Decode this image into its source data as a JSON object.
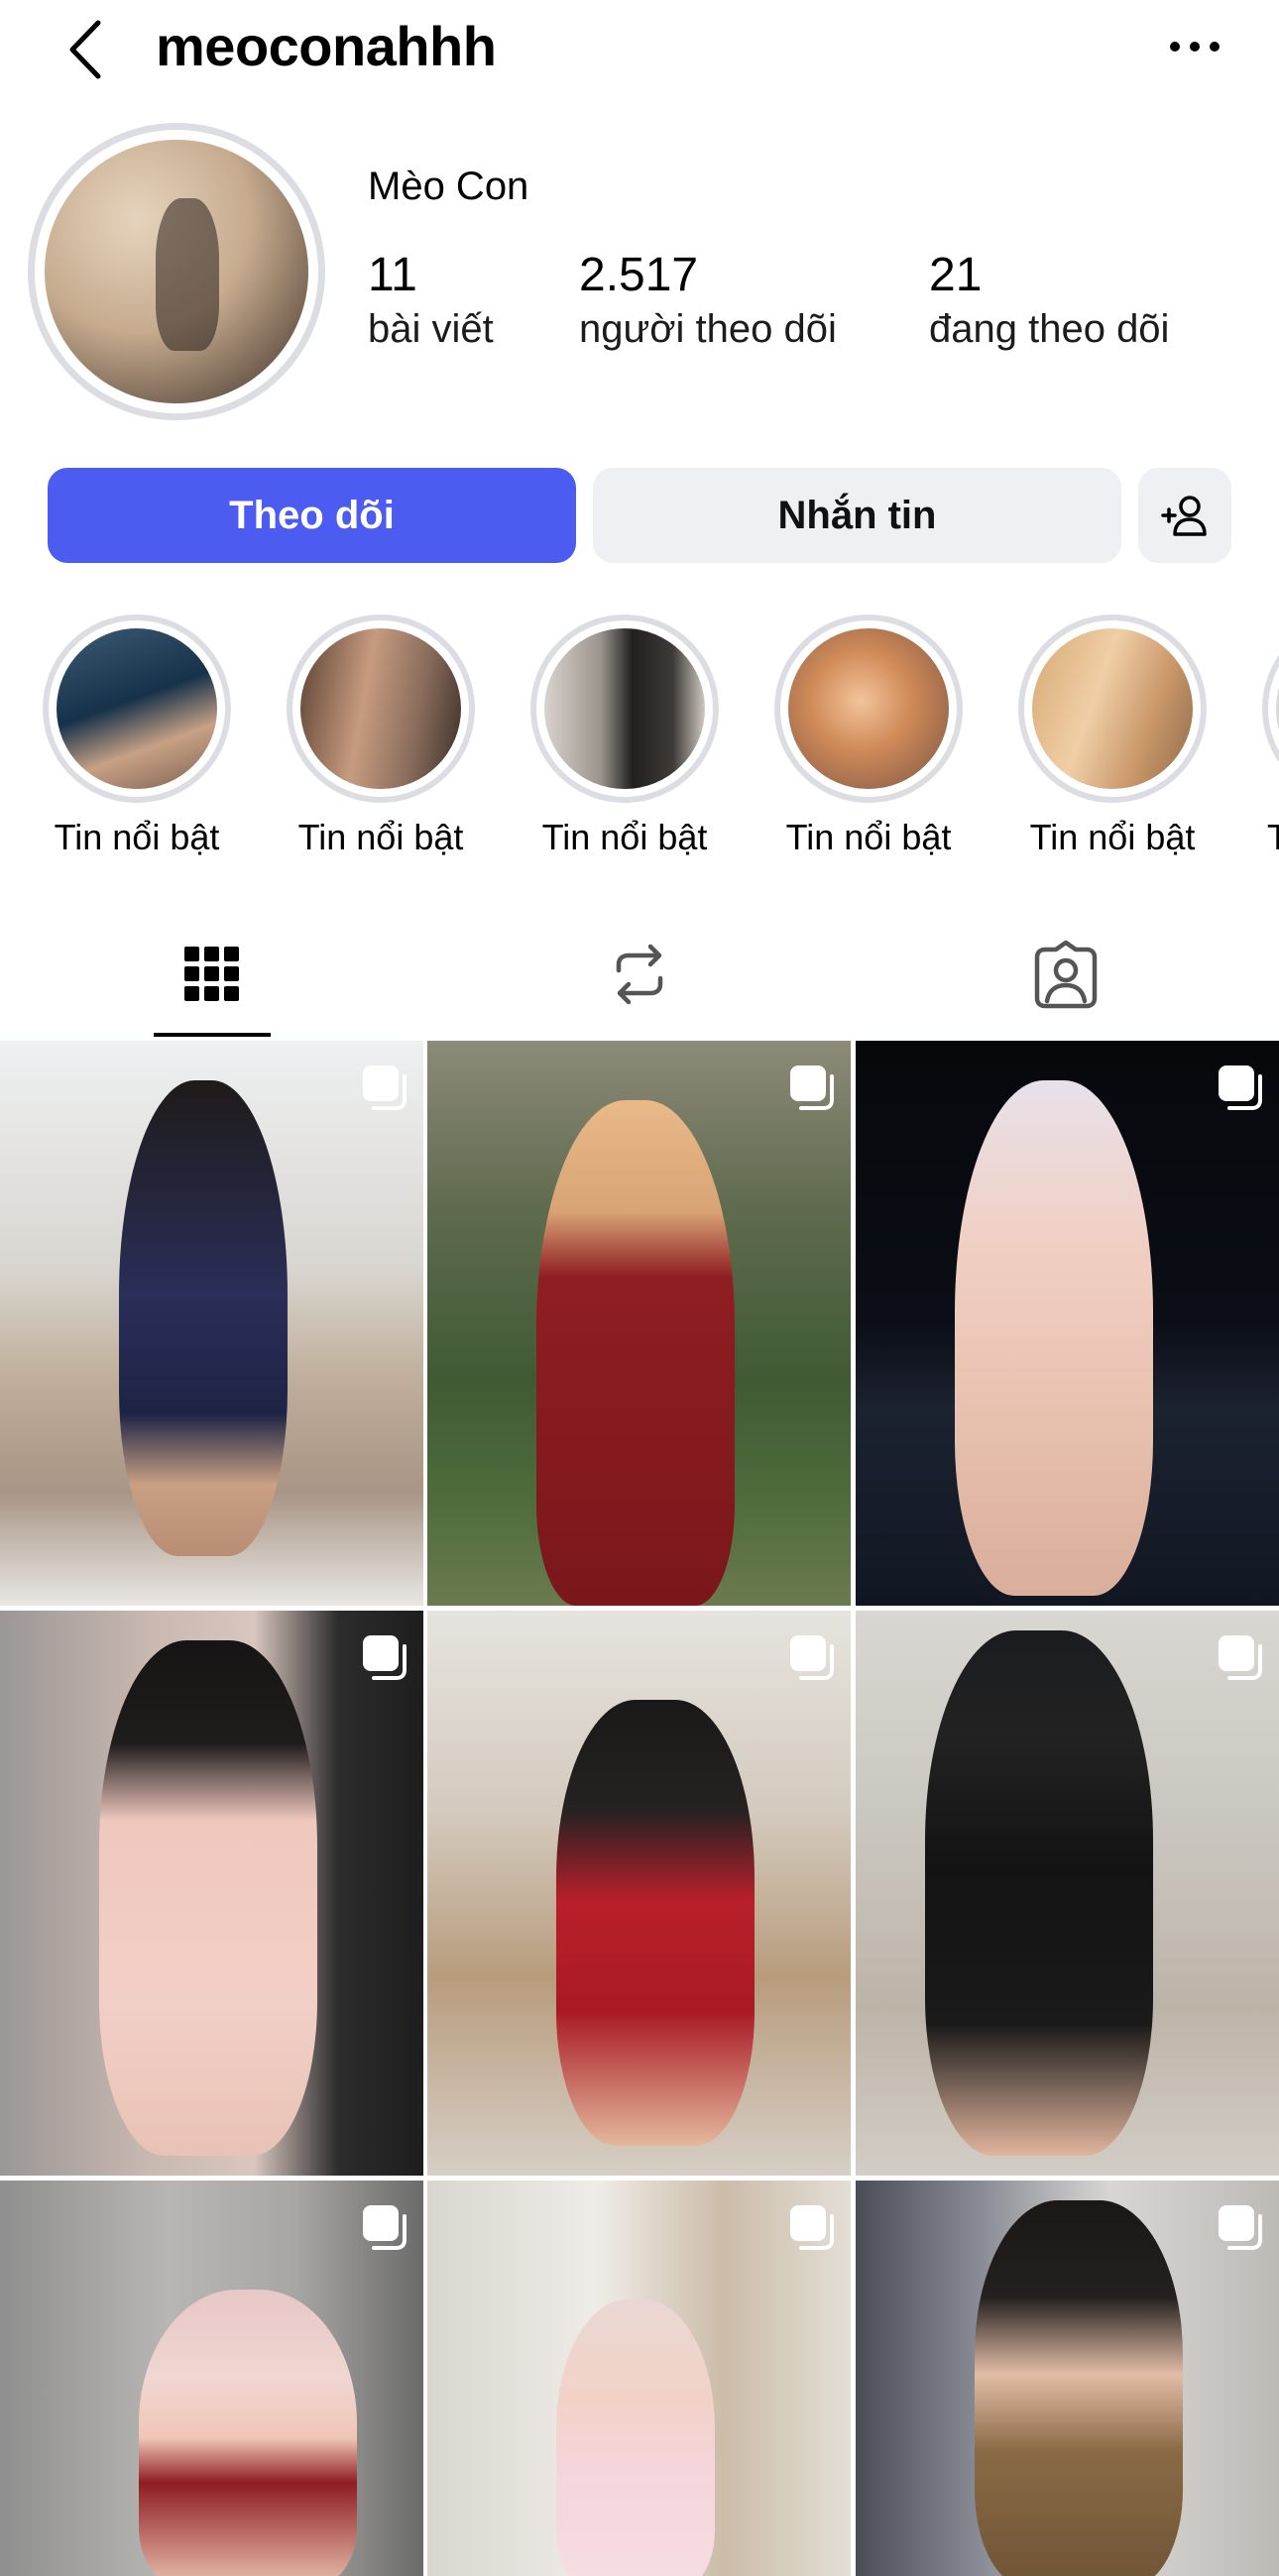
{
  "header": {
    "username": "meoconahhh",
    "back_icon": "chevron-left-icon",
    "more_icon": "ellipsis-icon"
  },
  "profile": {
    "display_name": "Mèo Con",
    "stats": [
      {
        "number": "11",
        "label": "bài viết"
      },
      {
        "number": "2.517",
        "label": "người theo dõi"
      },
      {
        "number": "21",
        "label": "đang theo dõi"
      }
    ]
  },
  "actions": {
    "follow_label": "Theo dõi",
    "message_label": "Nhắn tin",
    "add_user_icon": "person-add-icon"
  },
  "highlights": [
    {
      "label": "Tin nổi bật"
    },
    {
      "label": "Tin nổi bật"
    },
    {
      "label": "Tin nổi bật"
    },
    {
      "label": "Tin nổi bật"
    },
    {
      "label": "Tin nổi bật"
    },
    {
      "label": "T"
    }
  ],
  "tabs": [
    {
      "icon": "grid-icon",
      "active": true
    },
    {
      "icon": "reposts-icon",
      "active": false
    },
    {
      "icon": "tagged-icon",
      "active": false
    }
  ],
  "colors": {
    "accent": "#4c5cf0",
    "secondary_button": "#eef0f3",
    "ring": "#dcdde3"
  }
}
